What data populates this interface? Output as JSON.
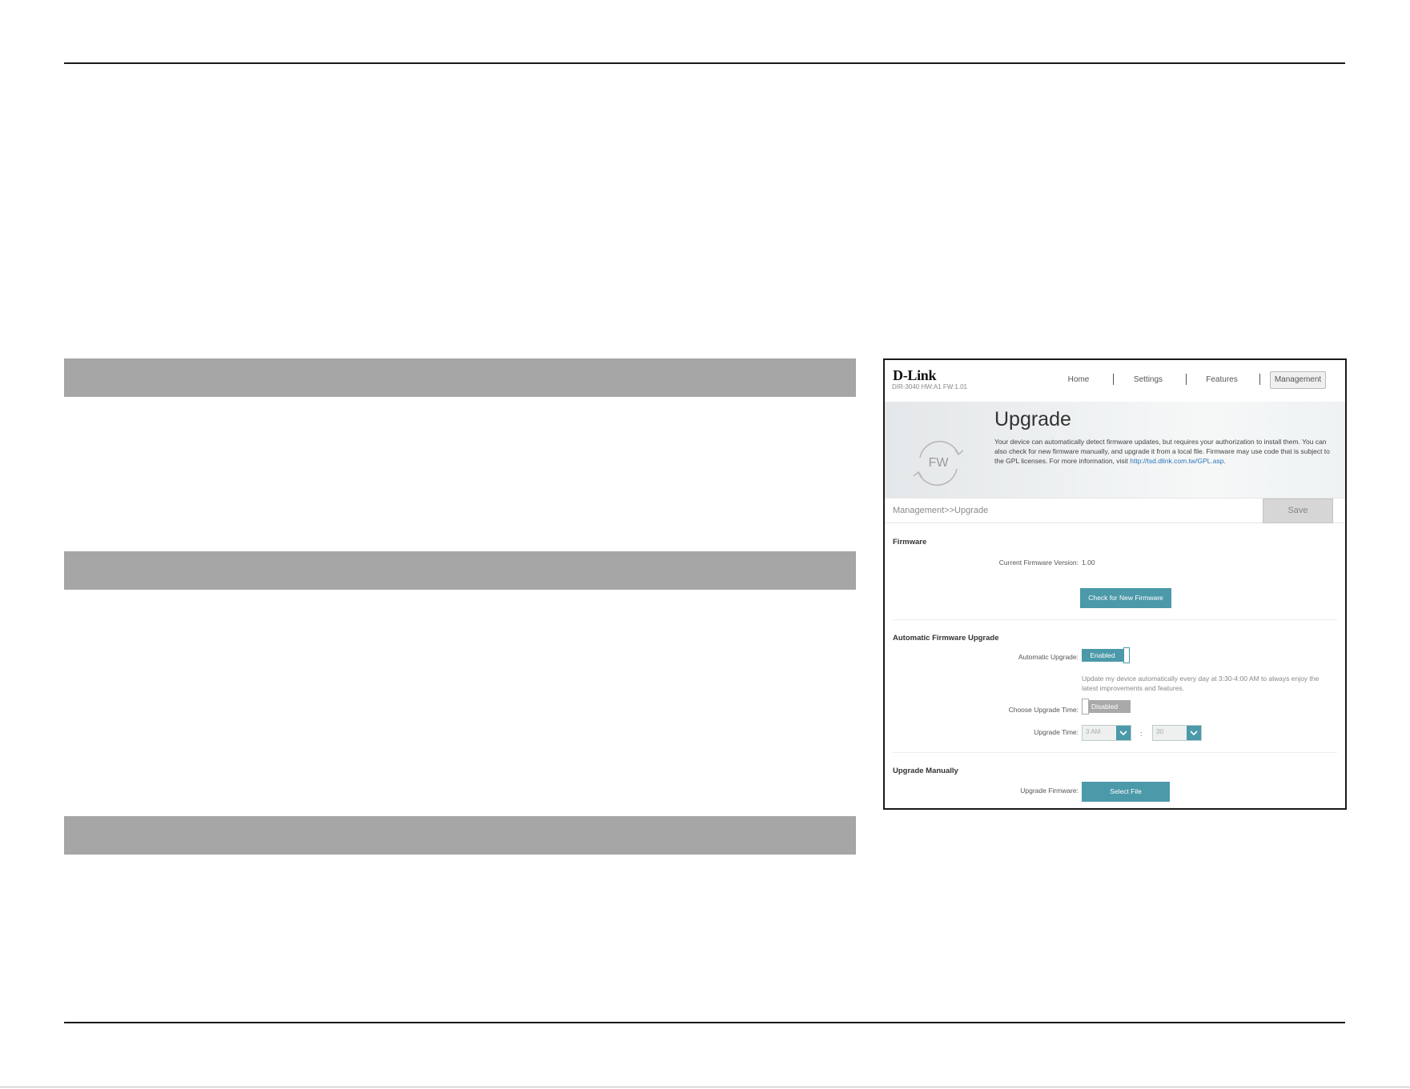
{
  "router": {
    "logo": "D-Link",
    "model": "DIR-3040 HW:A1 FW:1.01",
    "nav": {
      "home": "Home",
      "settings": "Settings",
      "features": "Features",
      "management": "Management"
    },
    "banner": {
      "icon_text": "FW",
      "title": "Upgrade",
      "description": "Your device can automatically detect firmware updates, but requires your authorization to install them. You can also check for new firmware manually, and upgrade it from a local file. Firmware may use code that is subject to the GPL licenses. For more information, visit ",
      "link_text": "http://tsd.dlink.com.tw/GPL.asp",
      "desc_end": "."
    },
    "breadcrumb": "Management>>Upgrade",
    "save_label": "Save",
    "firmware": {
      "section_title": "Firmware",
      "current_version_label": "Current Firmware Version:",
      "current_version_value": "1.00",
      "check_button": "Check for New Firmware"
    },
    "auto_upgrade": {
      "section_title": "Automatic Firmware Upgrade",
      "auto_label": "Automatic Upgrade:",
      "auto_state": "Enabled",
      "note": "Update my device automatically every day at 3:30-4:00 AM to always enjoy the latest improvements and features.",
      "choose_time_label": "Choose Upgrade Time:",
      "choose_time_state": "Disabled",
      "upgrade_time_label": "Upgrade Time:",
      "hour_value": "3 AM",
      "colon": ":",
      "minute_value": "30"
    },
    "manual": {
      "section_title": "Upgrade Manually",
      "upgrade_firmware_label": "Upgrade Firmware:",
      "select_file_button": "Select File"
    }
  },
  "colors": {
    "accent_teal": "#4b99a9",
    "section_bar_gray": "#a6a6a6"
  }
}
